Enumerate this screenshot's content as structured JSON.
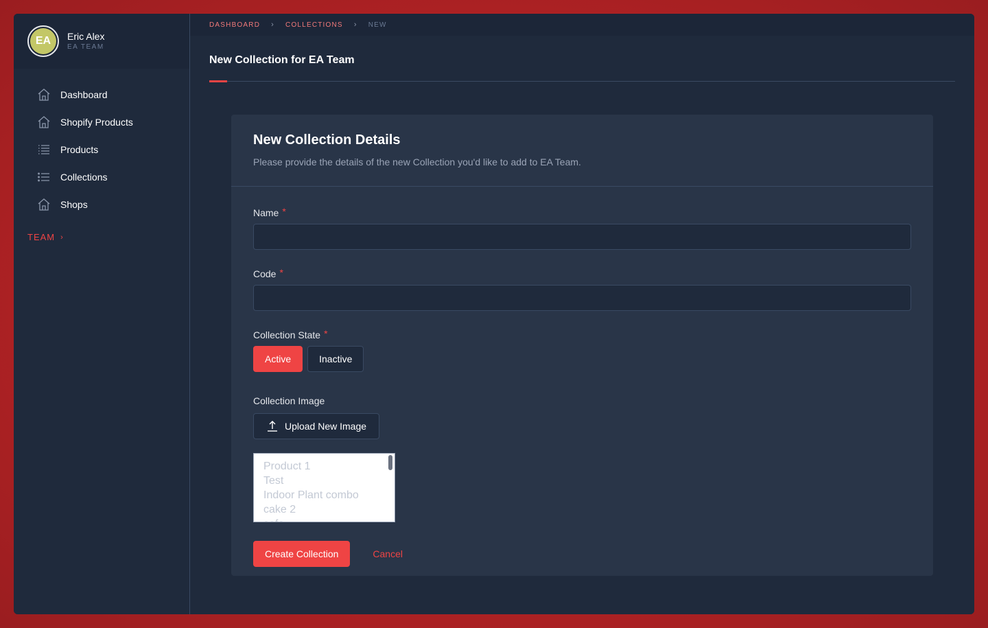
{
  "user": {
    "initials": "EA",
    "name": "Eric Alex",
    "team": "EA TEAM"
  },
  "sidebar": {
    "items": [
      {
        "label": "Dashboard",
        "icon": "home-icon"
      },
      {
        "label": "Shopify Products",
        "icon": "home-icon"
      },
      {
        "label": "Products",
        "icon": "list-icon"
      },
      {
        "label": "Collections",
        "icon": "list-icon"
      },
      {
        "label": "Shops",
        "icon": "home-icon"
      }
    ],
    "team_link": "TEAM",
    "team_chevron": "›"
  },
  "breadcrumb": {
    "items": [
      "DASHBOARD",
      "COLLECTIONS"
    ],
    "separator": "›",
    "current": "NEW"
  },
  "page": {
    "title": "New Collection for EA Team"
  },
  "card": {
    "title": "New Collection Details",
    "subtitle": "Please provide the details of the new Collection you'd like to add to EA Team."
  },
  "form": {
    "required_mark": "*",
    "name": {
      "label": "Name",
      "value": "",
      "placeholder": ""
    },
    "code": {
      "label": "Code",
      "value": "",
      "placeholder": ""
    },
    "state": {
      "label": "Collection State",
      "active_label": "Active",
      "inactive_label": "Inactive",
      "selected": "Active"
    },
    "image": {
      "label": "Collection Image",
      "upload_label": "Upload New Image"
    },
    "products": {
      "options": [
        "Product 1",
        "Test",
        "Indoor Plant combo",
        "cake 2",
        "sofa"
      ]
    },
    "create_label": "Create Collection",
    "cancel_label": "Cancel"
  },
  "colors": {
    "accent": "#ef4444",
    "background": "#1f2a3c",
    "card": "#293548",
    "avatar": "#c3c767"
  }
}
